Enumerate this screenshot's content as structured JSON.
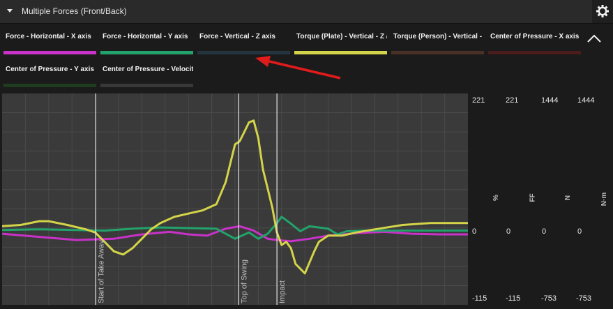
{
  "header": {
    "title": "Multiple Forces (Front/Back)"
  },
  "legend": [
    {
      "label": "Force - Horizontal - X axis",
      "color": "#c832c8"
    },
    {
      "label": "Force - Horizontal - Y axis",
      "color": "#22a36b"
    },
    {
      "label": "Force - Vertical - Z axis",
      "color": "#243540"
    },
    {
      "label": "Torque (Plate) - Vertical - Z axis",
      "color": "#d4d44a"
    },
    {
      "label": "Torque (Person) - Vertical - Z axis",
      "color": "#4a3128"
    },
    {
      "label": "Center of Pressure - X axis",
      "color": "#4a1c1c"
    },
    {
      "label": "Center of Pressure - Y axis",
      "color": "#1f3b20"
    },
    {
      "label": "Center of Pressure - Velocity",
      "color": "#383838"
    }
  ],
  "axes": {
    "columns": [
      {
        "unit": "%",
        "max": "221",
        "zero": "0",
        "min": "-115"
      },
      {
        "unit": "FF",
        "max": "221",
        "zero": "0",
        "min": "-115"
      },
      {
        "unit": "N",
        "max": "1444",
        "zero": "0",
        "min": "-753"
      },
      {
        "unit": "N·m",
        "max": "1444",
        "zero": "0",
        "min": "-753"
      }
    ]
  },
  "chart_data": {
    "type": "line",
    "x_range": [
      0,
      100
    ],
    "y_range": [
      -115,
      221
    ],
    "grid": true,
    "markers": [
      {
        "label": "Start of Take Away",
        "x": 20.1
      },
      {
        "label": "Top of Swing",
        "x": 50.8
      },
      {
        "label": "Impact",
        "x": 59.0
      }
    ],
    "series": [
      {
        "name": "Force - Horizontal - X axis",
        "color": "#c832c8",
        "x": [
          0,
          8,
          16,
          24,
          30,
          36,
          40,
          44,
          48,
          51,
          54,
          57,
          59,
          62,
          66,
          70,
          76,
          82,
          88,
          94,
          100
        ],
        "y": [
          -2,
          -7,
          -12,
          -10,
          -3,
          1,
          -3,
          -5,
          6,
          10,
          3,
          -10,
          -12,
          -14,
          -10,
          -5,
          -1,
          1,
          -2,
          -3,
          -3
        ]
      },
      {
        "name": "Force - Horizontal - Y axis",
        "color": "#22a36b",
        "x": [
          0,
          8,
          16,
          22,
          28,
          34,
          40,
          46,
          50,
          53,
          55,
          57,
          59,
          60,
          62,
          64,
          66,
          68,
          70,
          72,
          74,
          78,
          84,
          90,
          100
        ],
        "y": [
          4,
          5,
          4,
          3,
          6,
          8,
          7,
          6,
          -10,
          0,
          -10,
          -2,
          15,
          25,
          14,
          2,
          10,
          8,
          6,
          -3,
          2,
          3,
          3,
          3,
          3
        ]
      },
      {
        "name": "Torque (Plate) - Vertical - Z axis",
        "color": "#d4d44a",
        "x": [
          0,
          4,
          8,
          10,
          14,
          18,
          20,
          22,
          24,
          26,
          28,
          30,
          32,
          34,
          37,
          40,
          43,
          46,
          48,
          50,
          51,
          52,
          53,
          54,
          55,
          56,
          57,
          58,
          59,
          60,
          61,
          62,
          63,
          65,
          67,
          68,
          70,
          73,
          76,
          80,
          86,
          92,
          100
        ],
        "y": [
          10,
          12,
          18,
          18,
          12,
          5,
          0,
          -15,
          -30,
          -35,
          -25,
          -10,
          5,
          15,
          25,
          30,
          35,
          45,
          80,
          140,
          145,
          160,
          175,
          178,
          150,
          100,
          70,
          40,
          0,
          -20,
          -15,
          -25,
          -50,
          -65,
          -30,
          -15,
          -5,
          -5,
          0,
          5,
          12,
          15,
          15
        ]
      }
    ]
  }
}
